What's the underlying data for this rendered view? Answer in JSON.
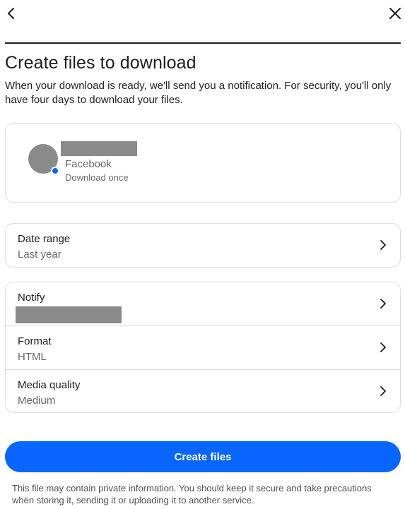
{
  "header": {
    "back_icon": "chevron-left-icon",
    "close_icon": "close-icon"
  },
  "page": {
    "title": "Create files to download",
    "description": "When your download is ready, we'll send you a notification. For security, you'll only have four days to download your files."
  },
  "account": {
    "platform": "Facebook",
    "frequency": "Download once",
    "badge_color": "#0866ff"
  },
  "date_range": {
    "label": "Date range",
    "value": "Last year"
  },
  "settings": [
    {
      "label": "Notify",
      "value": ""
    },
    {
      "label": "Format",
      "value": "HTML"
    },
    {
      "label": "Media quality",
      "value": "Medium"
    }
  ],
  "actions": {
    "create_label": "Create files",
    "button_color": "#0866ff"
  },
  "footer": {
    "note": "This file may contain private information. You should keep it secure and take precautions when storing it, sending it or uploading it to another service."
  }
}
